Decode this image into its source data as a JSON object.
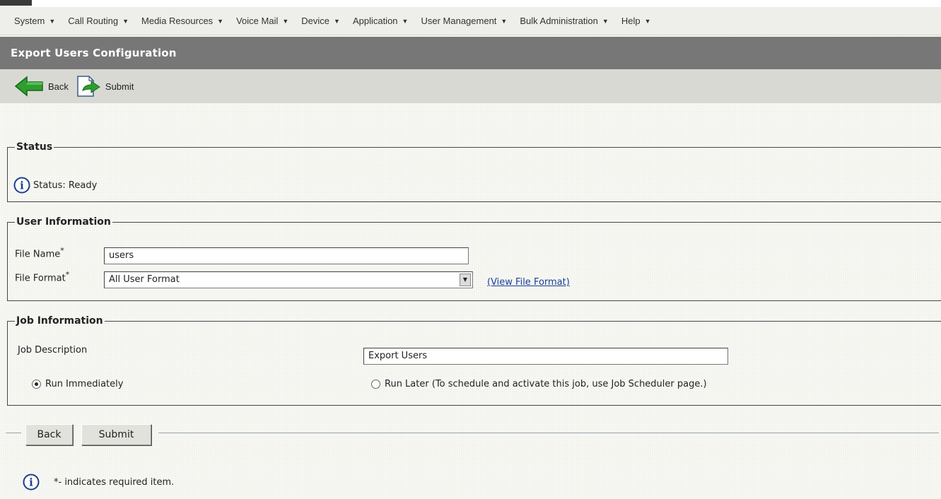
{
  "menu": [
    {
      "label": "System"
    },
    {
      "label": "Call Routing"
    },
    {
      "label": "Media Resources"
    },
    {
      "label": "Voice Mail"
    },
    {
      "label": "Device"
    },
    {
      "label": "Application"
    },
    {
      "label": "User Management"
    },
    {
      "label": "Bulk Administration"
    },
    {
      "label": "Help"
    }
  ],
  "page_title": "Export Users Configuration",
  "toolbar": {
    "back_label": "Back",
    "submit_label": "Submit"
  },
  "status": {
    "legend": "Status",
    "text": "Status: Ready"
  },
  "user_info": {
    "legend": "User Information",
    "file_name_label": "File Name",
    "file_name_value": "users",
    "file_format_label": "File Format",
    "file_format_value": "All User Format",
    "view_format_link": "(View File Format)",
    "required_mark": "*"
  },
  "job_info": {
    "legend": "Job Information",
    "description_label": "Job Description",
    "description_value": "Export Users",
    "run_immediately": "Run Immediately",
    "run_later": "Run Later (To schedule and activate this job, use Job Scheduler page.)"
  },
  "footer": {
    "back_label": "Back",
    "submit_label": "Submit",
    "required_note": "*- indicates required item."
  },
  "colors": {
    "title_bar": "#777777",
    "link": "#1a3f9a",
    "back_arrow": "#2e9e2e"
  }
}
